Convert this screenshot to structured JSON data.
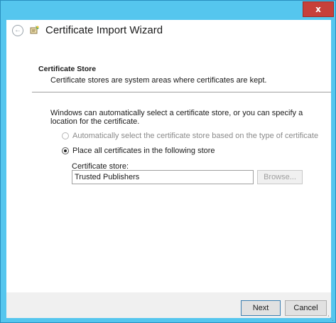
{
  "window": {
    "close_label": "x"
  },
  "header": {
    "title": "Certificate Import Wizard",
    "back_icon": "back-arrow-icon",
    "wizard_icon": "certificate-wizard-icon"
  },
  "section": {
    "title": "Certificate Store",
    "description": "Certificate stores are system areas where certificates are kept."
  },
  "intro_text": "Windows can automatically select a certificate store, or you can specify a location for the certificate.",
  "options": [
    {
      "label": "Automatically select the certificate store based on the type of certificate",
      "selected": false,
      "enabled": false
    },
    {
      "label": "Place all certificates in the following store",
      "selected": true,
      "enabled": true
    }
  ],
  "store": {
    "label": "Certificate store:",
    "value": "Trusted Publishers",
    "browse_label": "Browse..."
  },
  "footer": {
    "next_label": "Next",
    "cancel_label": "Cancel"
  },
  "colors": {
    "frame": "#55c6ee",
    "close": "#c7403a"
  }
}
